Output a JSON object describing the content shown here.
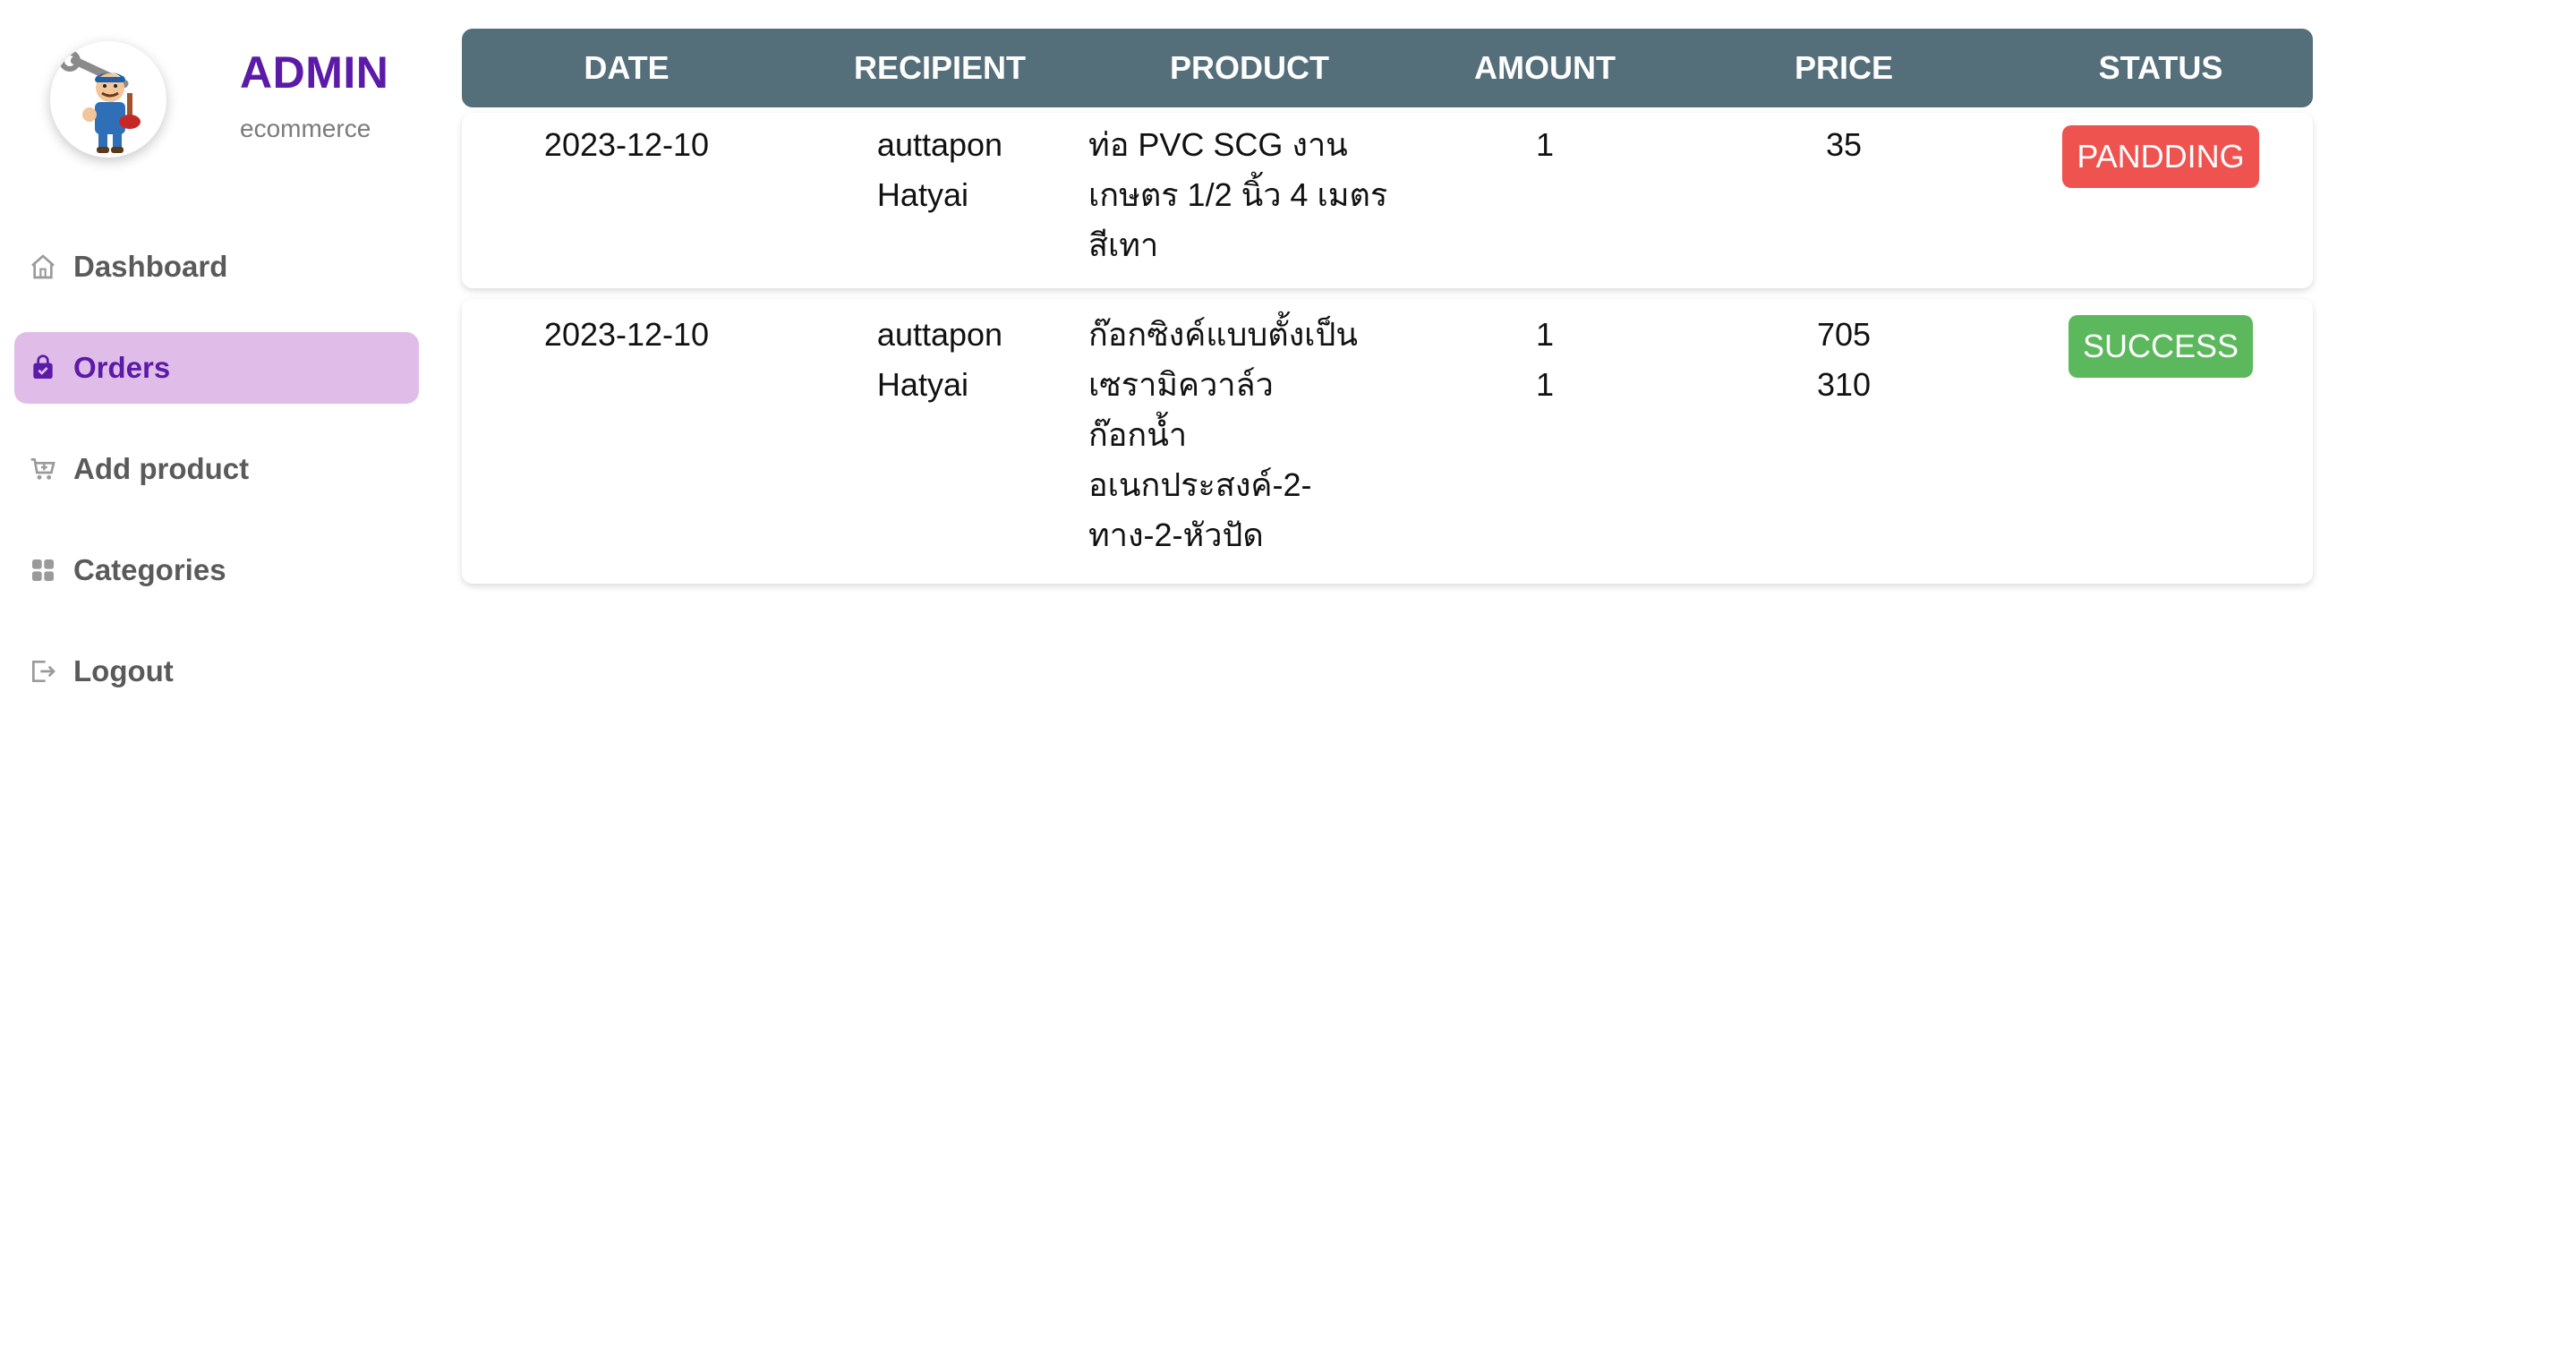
{
  "brand": {
    "title": "ADMIN",
    "subtitle": "ecommerce"
  },
  "sidebar": {
    "items": [
      {
        "label": "Dashboard",
        "icon": "home-icon",
        "active": false
      },
      {
        "label": "Orders",
        "icon": "shopping-bag-icon",
        "active": true
      },
      {
        "label": "Add product",
        "icon": "cart-plus-icon",
        "active": false
      },
      {
        "label": "Categories",
        "icon": "grid-icon",
        "active": false
      },
      {
        "label": "Logout",
        "icon": "logout-icon",
        "active": false
      }
    ]
  },
  "table": {
    "headers": {
      "date": "DATE",
      "recipient": "RECIPIENT",
      "product": "PRODUCT",
      "amount": "AMOUNT",
      "price": "PRICE",
      "status": "STATUS"
    },
    "rows": [
      {
        "date": "2023-12-10",
        "recipient_line1": "auttapon",
        "recipient_line2": "Hatyai",
        "product_lines": [
          "ท่อ PVC SCG งาน",
          "เกษตร 1/2 นิ้ว 4 เมตร",
          "สีเทา"
        ],
        "amounts": [
          "1"
        ],
        "prices": [
          "35"
        ],
        "status": "PANDDING",
        "status_color": "#ef5350"
      },
      {
        "date": "2023-12-10",
        "recipient_line1": "auttapon",
        "recipient_line2": "Hatyai",
        "product_lines": [
          "ก๊อกซิงค์แบบตั้งเป็น",
          "เซรามิควาล์ว",
          "ก๊อกน้ำ",
          "อเนกประสงค์-2-",
          "ทาง-2-หัวปัด"
        ],
        "amounts": [
          "1",
          "1"
        ],
        "prices": [
          "705",
          "310"
        ],
        "status": "SUCCESS",
        "status_color": "#5cb85c"
      }
    ]
  },
  "colors": {
    "accent": "#5b1aa8",
    "active_bg": "#e0bde8",
    "header_bg": "#546e7a"
  }
}
